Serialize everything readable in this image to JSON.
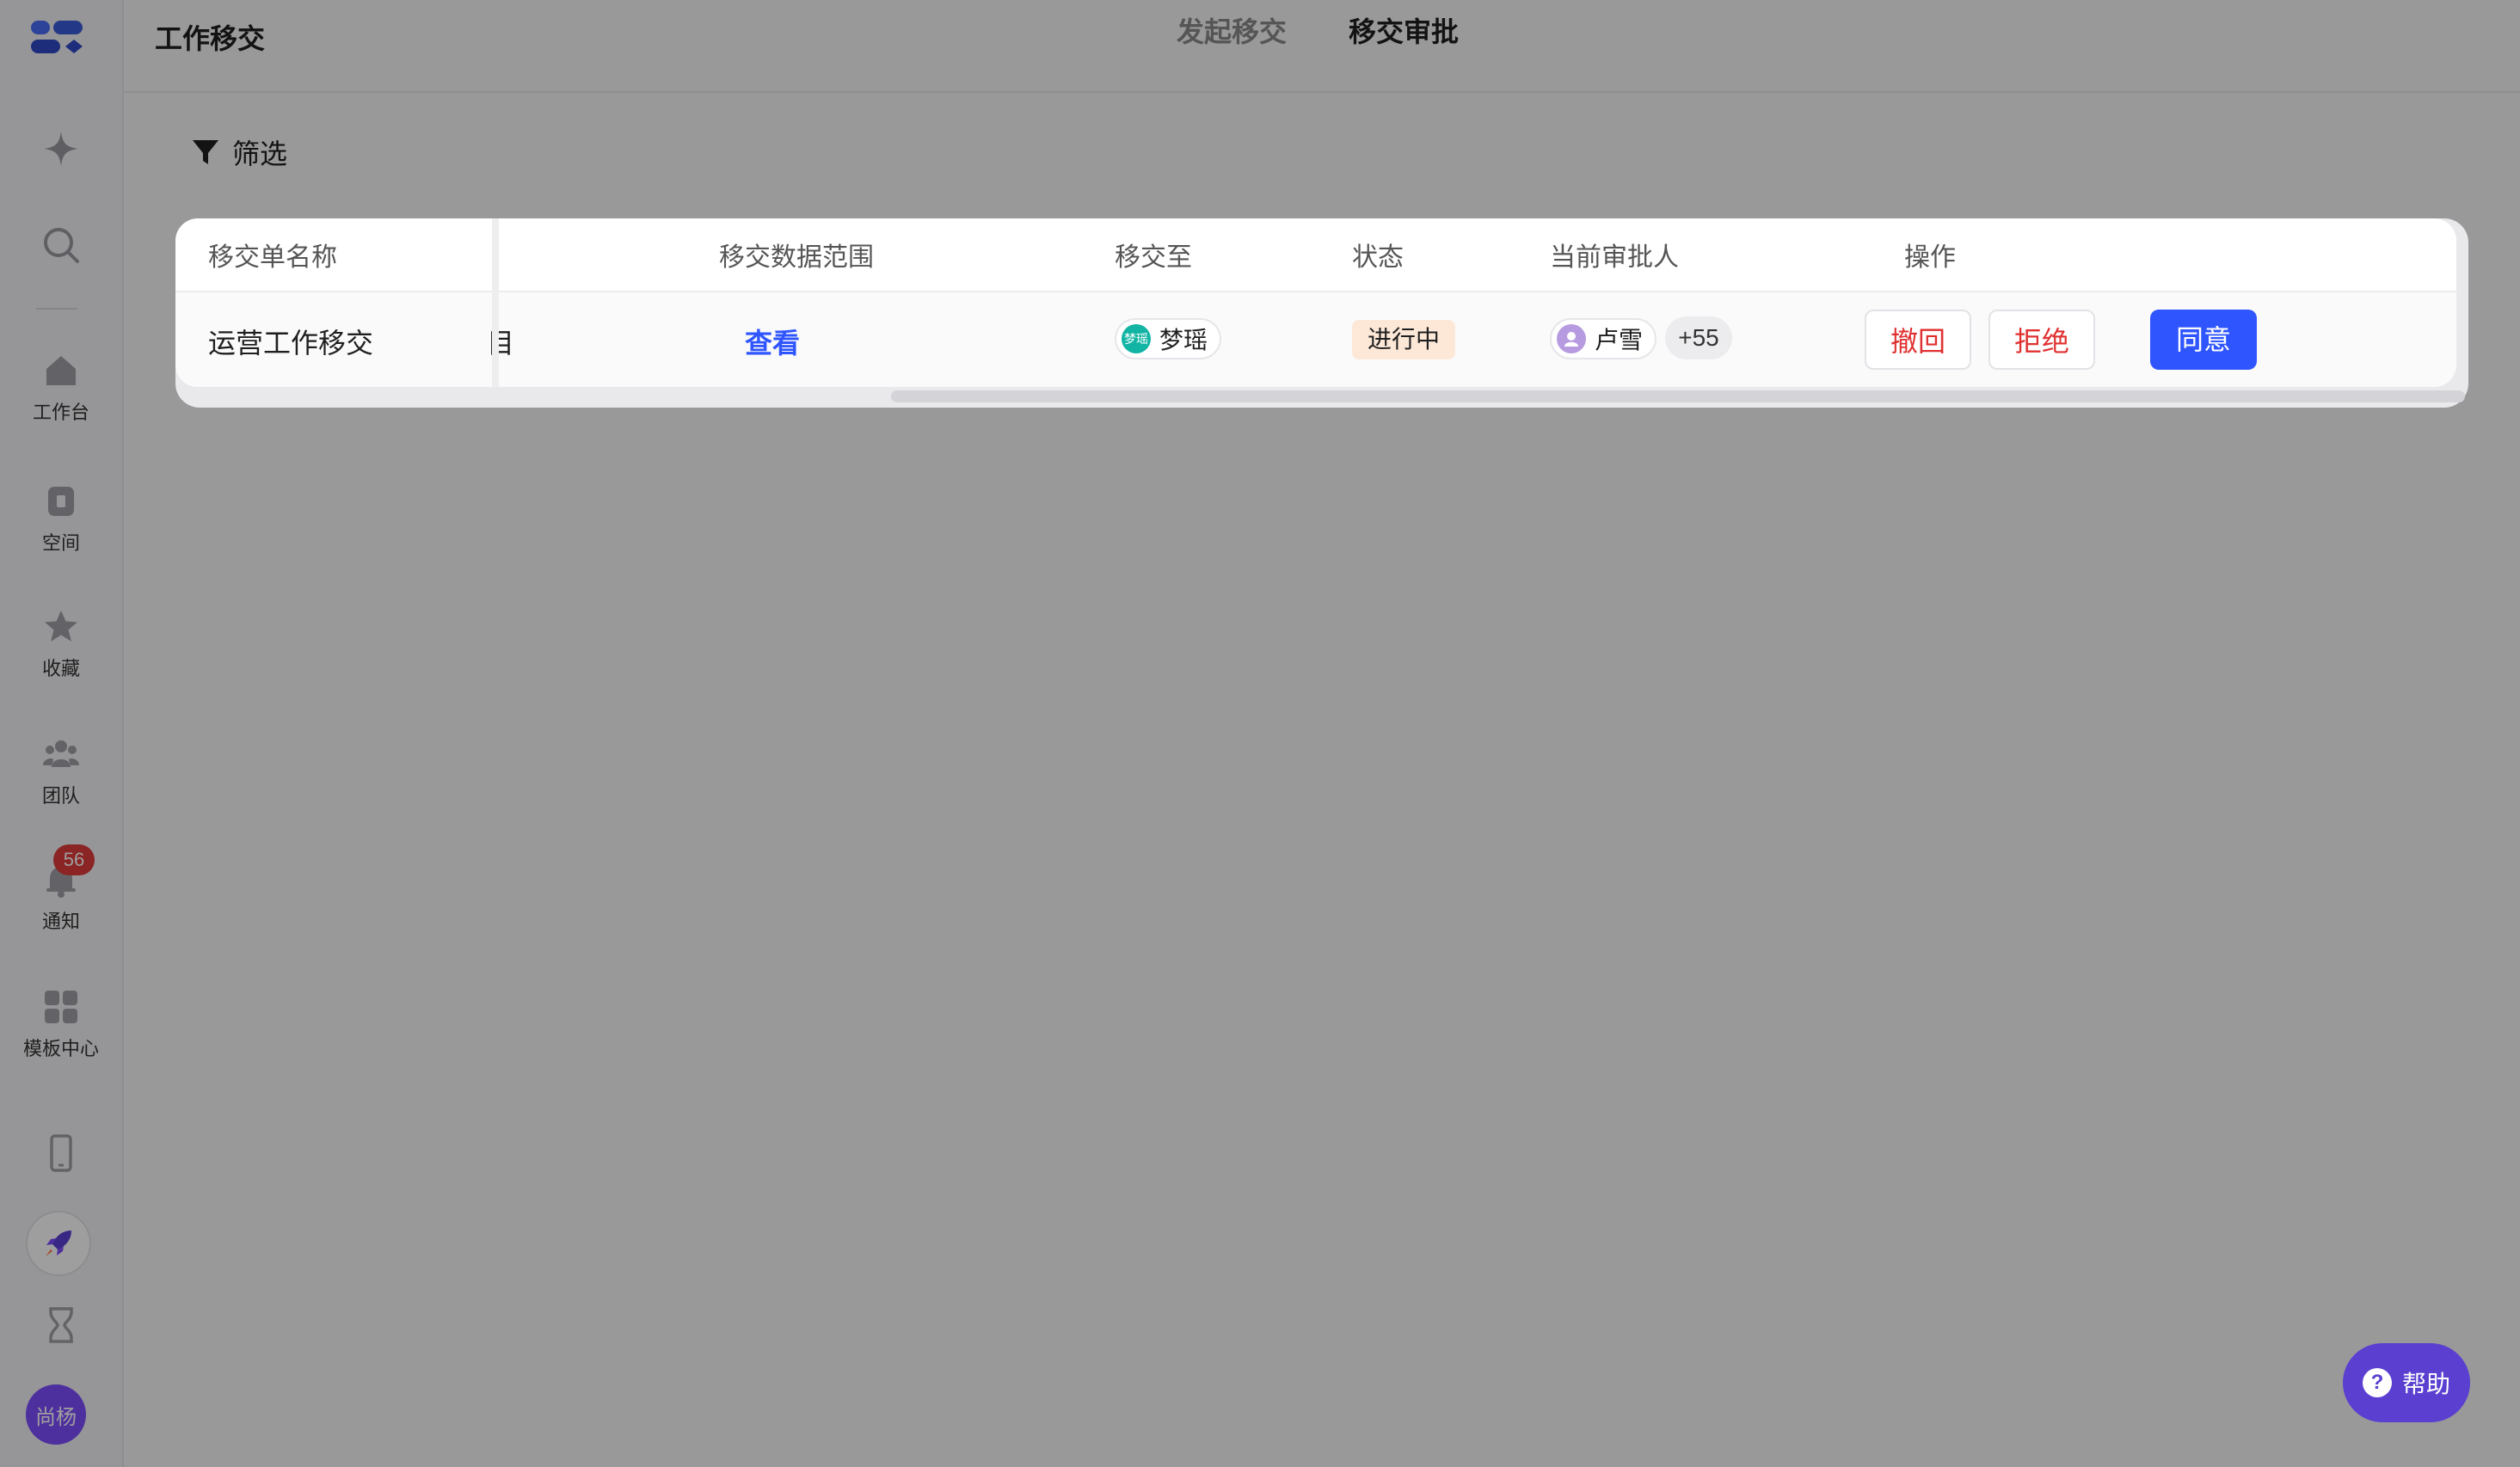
{
  "sidebar": {
    "items": [
      {
        "label": "工作台"
      },
      {
        "label": "空间"
      },
      {
        "label": "收藏"
      },
      {
        "label": "团队"
      },
      {
        "label": "通知",
        "badge": "56"
      },
      {
        "label": "模板中心"
      }
    ],
    "user_avatar": "尚杨"
  },
  "header": {
    "title": "工作移交",
    "tabs": [
      {
        "label": "发起移交",
        "active": false
      },
      {
        "label": "移交审批",
        "active": true
      }
    ]
  },
  "filter": {
    "label": "筛选"
  },
  "table": {
    "columns": [
      "移交单名称",
      "移交数据范围",
      "移交至",
      "状态",
      "当前审批人",
      "操作"
    ],
    "rows": [
      {
        "name": "运营工作移交",
        "clipped_text": "目",
        "scope_link": "查看",
        "transfer_to": {
          "name": "梦瑶",
          "avatar_text": "梦瑶"
        },
        "status": "进行中",
        "approver": {
          "name": "卢雪",
          "more": "+55"
        },
        "actions": {
          "withdraw": "撤回",
          "reject": "拒绝",
          "agree": "同意"
        }
      }
    ]
  },
  "help": {
    "label": "帮助"
  },
  "colors": {
    "primary": "#2f55ff",
    "danger": "#e03131",
    "status_bg": "#fde8d7",
    "help_bg": "#5a3fd0"
  }
}
